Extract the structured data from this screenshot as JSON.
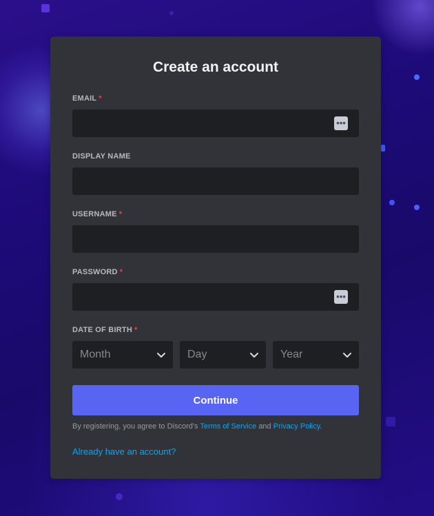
{
  "title": "Create an account",
  "fields": {
    "email": {
      "label": "EMAIL",
      "required_mark": "*",
      "value": "",
      "placeholder": ""
    },
    "display_name": {
      "label": "DISPLAY NAME",
      "value": "",
      "placeholder": ""
    },
    "username": {
      "label": "USERNAME",
      "required_mark": "*",
      "value": "",
      "placeholder": ""
    },
    "password": {
      "label": "PASSWORD",
      "required_mark": "*",
      "value": "",
      "placeholder": ""
    }
  },
  "password_manager_icon": "password-manager-icon",
  "dob": {
    "label": "DATE OF BIRTH",
    "required_mark": "*",
    "month_placeholder": "Month",
    "day_placeholder": "Day",
    "year_placeholder": "Year"
  },
  "continue_label": "Continue",
  "terms": {
    "prefix": "By registering, you agree to Discord's",
    "tos": "Terms of Service",
    "and": "and",
    "privacy": "Privacy Policy",
    "suffix": "."
  },
  "login_link": "Already have an account?",
  "colors": {
    "accent": "#5865f2",
    "link": "#00a8fc",
    "required": "#f23f43",
    "card": "#313338",
    "input": "#1e1f22"
  }
}
